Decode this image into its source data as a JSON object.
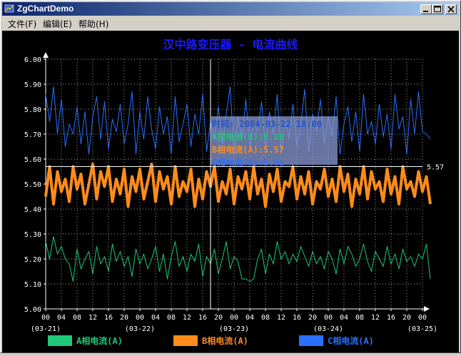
{
  "window": {
    "title": "ZgChartDemo"
  },
  "menu": [
    {
      "id": "file",
      "label": "文件(F)"
    },
    {
      "id": "edit",
      "label": "编辑(E)"
    },
    {
      "id": "help",
      "label": "帮助(H)"
    }
  ],
  "colors": {
    "title": "#1a1aff",
    "axis": "#ffffff",
    "grid": "#c8c8c8",
    "tooltip_bg": "#8a9ad6"
  },
  "chart_data": {
    "type": "line",
    "title": "汉中路变压器 - 电流曲线",
    "ylim": [
      5.0,
      6.0
    ],
    "yticks": [
      "5.00",
      "5.10",
      "5.20",
      "5.30",
      "5.40",
      "5.50",
      "5.60",
      "5.70",
      "5.80",
      "5.90",
      "6.00"
    ],
    "hour_ticks": [
      "00",
      "04",
      "08",
      "12",
      "16",
      "20",
      "00",
      "04",
      "08",
      "12",
      "16",
      "20",
      "00",
      "04",
      "08",
      "12",
      "16",
      "20",
      "00",
      "04",
      "08",
      "12",
      "16",
      "20",
      "00"
    ],
    "date_ticks": [
      "(03-21)",
      "(03-22)",
      "(03-23)",
      "(03-24)",
      "(03-25)"
    ],
    "x_range": [
      "2004-03-21 00:00",
      "2004-03-25 00:00"
    ],
    "x_step_hours": 1,
    "grid": true,
    "legend_position": "bottom",
    "cursor": {
      "label": "5.57",
      "value": 5.57,
      "time": "2004-03-22 18:00",
      "tooltip": [
        {
          "text": "时间: 2004-03-22 18:00",
          "color": "#2255cc"
        },
        {
          "text": "A相电流(A):5.26",
          "color": "#1ec878"
        },
        {
          "text": "B相电流(A):5.57",
          "color": "#ff8c1a"
        },
        {
          "text": "C相电流(A):5.81",
          "color": "#2a70ff"
        }
      ]
    },
    "series": [
      {
        "name": "A相电流(A)",
        "color": "#1ec878",
        "width": 1,
        "values": [
          5.27,
          5.2,
          5.29,
          5.22,
          5.25,
          5.2,
          5.18,
          5.11,
          5.24,
          5.16,
          5.2,
          5.23,
          5.14,
          5.25,
          5.18,
          5.21,
          5.15,
          5.26,
          5.19,
          5.23,
          5.17,
          5.21,
          5.13,
          5.24,
          5.18,
          5.22,
          5.16,
          5.2,
          5.25,
          5.15,
          5.22,
          5.12,
          5.21,
          5.27,
          5.17,
          5.21,
          5.15,
          5.22,
          5.19,
          5.26,
          5.13,
          5.21,
          5.18,
          5.24,
          5.14,
          5.2,
          5.27,
          5.16,
          5.21,
          5.19,
          5.12,
          5.12,
          5.11,
          5.12,
          5.2,
          5.24,
          5.14,
          5.22,
          5.18,
          5.27,
          5.2,
          5.23,
          5.18,
          5.22,
          5.19,
          5.25,
          5.21,
          5.17,
          5.23,
          5.18,
          5.21,
          5.16,
          5.23,
          5.2,
          5.14,
          5.24,
          5.18,
          5.25,
          5.22,
          5.17,
          5.2,
          5.26,
          5.19,
          5.15,
          5.23,
          5.2,
          5.17,
          5.25,
          5.18,
          5.22,
          5.16,
          5.24,
          5.19,
          5.21,
          5.17,
          5.22,
          5.2,
          5.26,
          5.12
        ]
      },
      {
        "name": "B相电流(A)",
        "color": "#ff8c1a",
        "width": 4,
        "values": [
          5.45,
          5.57,
          5.42,
          5.55,
          5.47,
          5.52,
          5.43,
          5.57,
          5.48,
          5.54,
          5.42,
          5.5,
          5.58,
          5.44,
          5.55,
          5.49,
          5.57,
          5.43,
          5.52,
          5.46,
          5.56,
          5.41,
          5.53,
          5.47,
          5.56,
          5.44,
          5.51,
          5.58,
          5.43,
          5.55,
          5.48,
          5.53,
          5.42,
          5.57,
          5.45,
          5.51,
          5.47,
          5.56,
          5.41,
          5.52,
          5.44,
          5.55,
          5.49,
          5.57,
          5.43,
          5.51,
          5.46,
          5.56,
          5.42,
          5.53,
          5.48,
          5.55,
          5.44,
          5.57,
          5.46,
          5.52,
          5.41,
          5.54,
          5.47,
          5.56,
          5.43,
          5.51,
          5.49,
          5.57,
          5.44,
          5.53,
          5.46,
          5.55,
          5.42,
          5.51,
          5.48,
          5.56,
          5.45,
          5.52,
          5.43,
          5.57,
          5.47,
          5.54,
          5.41,
          5.52,
          5.46,
          5.57,
          5.44,
          5.55,
          5.48,
          5.51,
          5.43,
          5.56,
          5.46,
          5.53,
          5.42,
          5.57,
          5.48,
          5.51,
          5.45,
          5.55,
          5.47,
          5.53,
          5.42
        ]
      },
      {
        "name": "C相电流(A)",
        "color": "#2a70ff",
        "width": 1,
        "values": [
          5.86,
          5.75,
          5.89,
          5.7,
          5.84,
          5.65,
          5.74,
          5.7,
          5.81,
          5.66,
          5.79,
          5.62,
          5.77,
          5.85,
          5.68,
          5.83,
          5.64,
          5.76,
          5.71,
          5.82,
          5.66,
          5.74,
          5.87,
          5.62,
          5.79,
          5.68,
          5.85,
          5.72,
          5.64,
          5.81,
          5.7,
          5.77,
          5.62,
          5.85,
          5.67,
          5.74,
          5.82,
          5.65,
          5.78,
          5.7,
          5.86,
          5.63,
          5.75,
          5.68,
          5.81,
          5.66,
          5.78,
          5.89,
          5.62,
          5.77,
          5.68,
          5.84,
          5.65,
          5.75,
          5.71,
          5.83,
          5.64,
          5.79,
          5.7,
          5.86,
          5.62,
          5.76,
          5.68,
          5.82,
          5.65,
          5.74,
          5.88,
          5.63,
          5.78,
          5.71,
          5.84,
          5.66,
          5.77,
          5.69,
          5.85,
          5.62,
          5.74,
          5.81,
          5.67,
          5.79,
          5.63,
          5.86,
          5.7,
          5.75,
          5.66,
          5.82,
          5.69,
          5.78,
          5.64,
          5.86,
          5.72,
          5.77,
          5.62,
          5.84,
          5.7,
          5.87,
          5.71,
          5.7,
          5.68
        ]
      }
    ]
  }
}
